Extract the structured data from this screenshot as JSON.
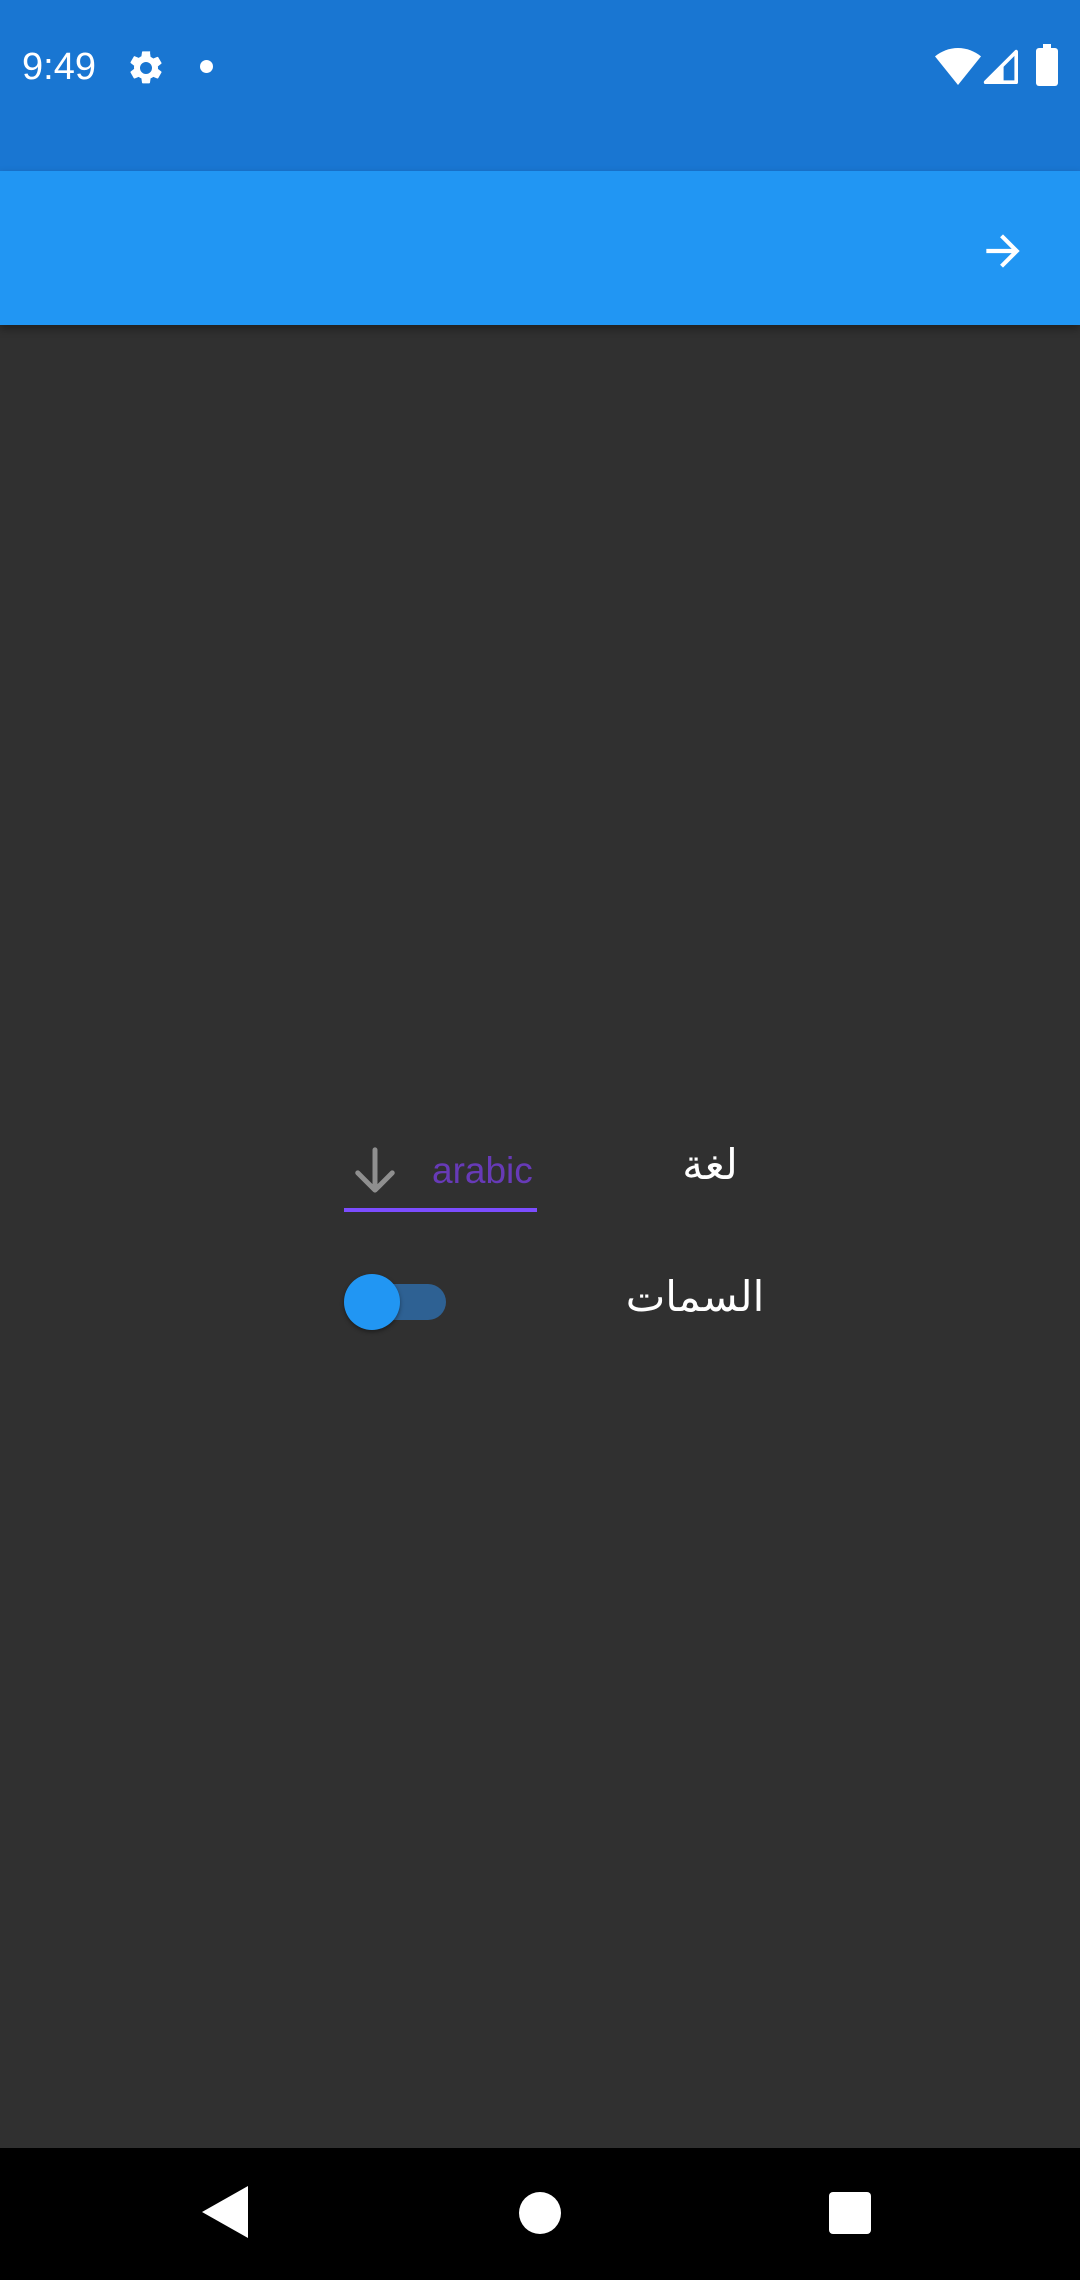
{
  "status_bar": {
    "time": "9:49",
    "icons": [
      "gear-icon",
      "notification-dot-icon",
      "wifi-icon",
      "cell-signal-icon",
      "battery-icon"
    ],
    "background_color": "#1976D2"
  },
  "app_bar": {
    "background_color": "#2196F3",
    "action_icon": "arrow-forward-icon"
  },
  "settings": {
    "language": {
      "label": "لغة",
      "selected_value": "arabic",
      "dropdown_icon": "arrow-down-icon",
      "accent_color": "#7C4DFF",
      "value_color": "#673AB7"
    },
    "theme": {
      "label": "السمات",
      "toggle_on": true,
      "thumb_color": "#2196F3"
    }
  },
  "nav_bar": {
    "icons": [
      "back-triangle-icon",
      "home-circle-icon",
      "recents-square-icon"
    ]
  },
  "colors": {
    "page_background": "#303030",
    "text_primary": "#FFFFFF"
  }
}
